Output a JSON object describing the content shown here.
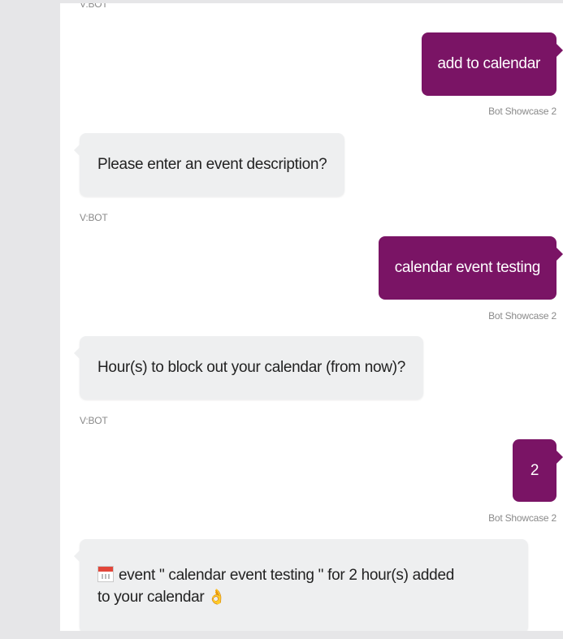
{
  "messages": [
    {
      "role": "bot-sender",
      "text": "V:BOT"
    },
    {
      "role": "user",
      "text": "add to calendar",
      "sender": "Bot Showcase 2"
    },
    {
      "role": "bot",
      "text": "Please enter an event description?",
      "sender": "V:BOT"
    },
    {
      "role": "user",
      "text": "calendar event testing",
      "sender": "Bot Showcase 2"
    },
    {
      "role": "bot",
      "text": "Hour(s) to block out your calendar (from now)?",
      "sender": "V:BOT"
    },
    {
      "role": "user",
      "text": "2",
      "sender": "Bot Showcase 2"
    },
    {
      "role": "bot",
      "icon": "calendar-icon",
      "line1": "event \" calendar event testing \" for 2 hour(s) added",
      "line2": "to your calendar",
      "emoji": "ok-hand-icon",
      "emoji_char": "👌"
    }
  ],
  "colors": {
    "user_bubble": "#7a1465",
    "bot_bubble": "#eeeff0",
    "sidebar": "#e6e6e8"
  }
}
